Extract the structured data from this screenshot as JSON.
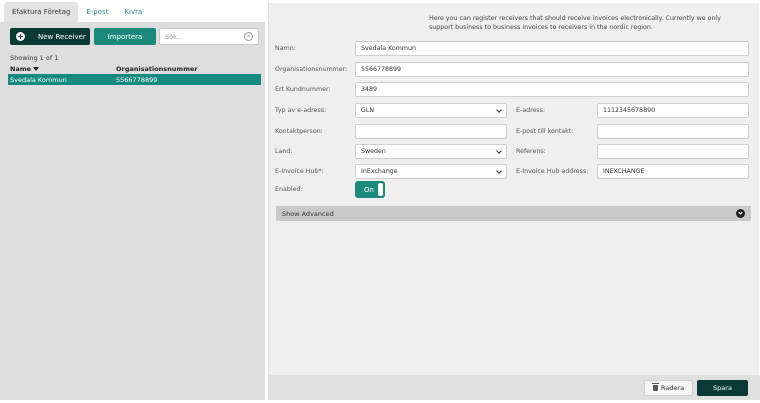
{
  "tabs": [
    {
      "label": "Efaktura Företag",
      "active": true
    },
    {
      "label": "E-post",
      "active": false
    },
    {
      "label": "Kivra",
      "active": false
    }
  ],
  "toolbar": {
    "new_label": "New Receiver",
    "import_label": "Importera",
    "search_placeholder": "Sök..."
  },
  "list": {
    "showing": "Showing 1 of 1",
    "columns": [
      "Name",
      "Organisationsnummer"
    ],
    "rows": [
      {
        "name": "Svedala Kommun",
        "org": "5566778899",
        "selected": true
      }
    ]
  },
  "form": {
    "info": "Here you can register receivers that should receive invoices electronically. Currently we only support business to business invoices to receivers in the nordic region.",
    "name_label": "Namn:",
    "name_value": "Svedala Kommun",
    "org_label": "Organisationsnummer:",
    "org_value": "5566778899",
    "customer_no_label": "Ert Kundnummer:",
    "customer_no_value": "3489",
    "address_type_label": "Typ av e-adress:",
    "address_type_value": "GLN",
    "eaddress_label": "E-adress:",
    "eaddress_value": "1112345678890",
    "contact_label": "Kontaktperson:",
    "contact_value": "",
    "contact_email_label": "E-post till kontakt:",
    "contact_email_value": "",
    "country_label": "Land:",
    "country_value": "Sweden",
    "reference_label": "Referens:",
    "reference_value": "",
    "hub_label": "E-Invoice Hub*:",
    "hub_value": "InExchange",
    "hub_address_label": "E-Invoice Hub address:",
    "hub_address_value": "INEXCHANGE",
    "enabled_label": "Enabled:",
    "enabled_value": "On",
    "advanced_label": "Show Advanced"
  },
  "footer": {
    "delete_label": "Radera",
    "save_label": "Spara"
  },
  "colors": {
    "accent": "#1b8a7c",
    "dark": "#0b3a36",
    "selected_row": "#168a81"
  }
}
